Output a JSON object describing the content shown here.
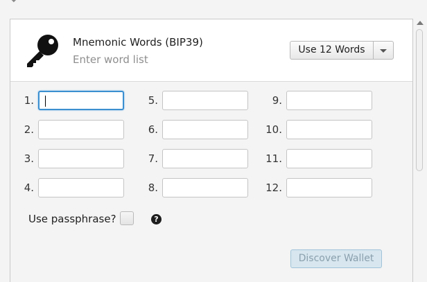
{
  "header": {
    "title": "Mnemonic Words (BIP39)",
    "subtitle": "Enter word list",
    "icon": "key-icon",
    "word_count_button": "Use 12 Words"
  },
  "words": [
    {
      "number": "1.",
      "value": ""
    },
    {
      "number": "2.",
      "value": ""
    },
    {
      "number": "3.",
      "value": ""
    },
    {
      "number": "4.",
      "value": ""
    },
    {
      "number": "5.",
      "value": ""
    },
    {
      "number": "6.",
      "value": ""
    },
    {
      "number": "7.",
      "value": ""
    },
    {
      "number": "8.",
      "value": ""
    },
    {
      "number": "9.",
      "value": ""
    },
    {
      "number": "10.",
      "value": ""
    },
    {
      "number": "11.",
      "value": ""
    },
    {
      "number": "12.",
      "value": ""
    }
  ],
  "passphrase": {
    "label": "Use passphrase?",
    "checked": false,
    "help_icon": "question-circle-icon",
    "help_glyph": "?"
  },
  "actions": {
    "discover_label": "Discover Wallet"
  }
}
